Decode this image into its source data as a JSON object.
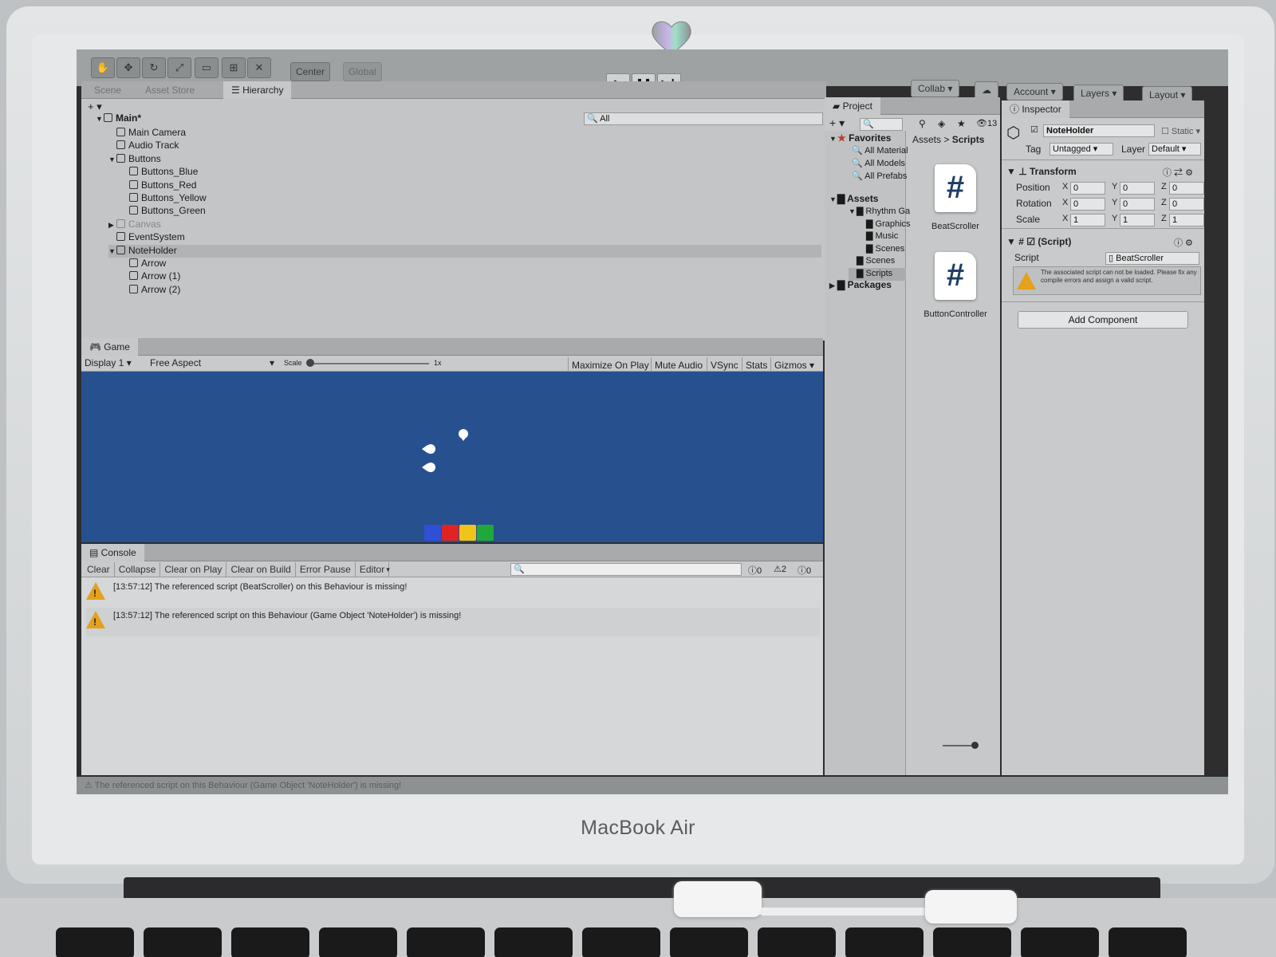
{
  "device": {
    "brand": "MacBook Air"
  },
  "toolbar": {
    "center_label": "Center",
    "global_label": "Global",
    "collab_label": "Collab",
    "account_label": "Account",
    "layers_label": "Layers",
    "layout_label": "Layout"
  },
  "hierarchy": {
    "tabs": [
      "Scene",
      "Asset Store",
      "Hierarchy"
    ],
    "search_placeholder": "All",
    "scene_name": "Main*",
    "items": [
      {
        "label": "Main Camera",
        "level": 1
      },
      {
        "label": "Audio Track",
        "level": 1
      },
      {
        "label": "Buttons",
        "level": 1
      },
      {
        "label": "Buttons_Blue",
        "level": 2
      },
      {
        "label": "Buttons_Red",
        "level": 2
      },
      {
        "label": "Buttons_Yellow",
        "level": 2
      },
      {
        "label": "Buttons_Green",
        "level": 2
      },
      {
        "label": "Canvas",
        "level": 1
      },
      {
        "label": "EventSystem",
        "level": 1
      },
      {
        "label": "NoteHolder",
        "level": 1
      },
      {
        "label": "Arrow",
        "level": 2
      },
      {
        "label": "Arrow (1)",
        "level": 2
      },
      {
        "label": "Arrow (2)",
        "level": 2
      }
    ]
  },
  "game": {
    "tab_label": "Game",
    "display": "Display 1",
    "aspect": "Free Aspect",
    "scale_label": "Scale",
    "scale_value": "1x",
    "controls": [
      "Maximize On Play",
      "Mute Audio",
      "VSync",
      "Stats",
      "Gizmos"
    ],
    "button_colors": [
      "#2f4fd6",
      "#e02424",
      "#f0c419",
      "#21a83b"
    ]
  },
  "console": {
    "tab_label": "Console",
    "buttons": [
      "Clear",
      "Collapse",
      "Clear on Play",
      "Clear on Build",
      "Error Pause",
      "Editor"
    ],
    "counts": {
      "info": "0",
      "warnings": "2",
      "errors": "0"
    },
    "messages": [
      "[13:57:12] The referenced script (BeatScroller) on this Behaviour is missing!",
      "[13:57:12] The referenced script on this Behaviour (Game Object 'NoteHolder') is missing!"
    ],
    "status_bar": "The referenced script on this Behaviour (Game Object 'NoteHolder') is missing!"
  },
  "project": {
    "tab_label": "Project",
    "hidden_count": "13",
    "favorites_label": "Favorites",
    "favorites": [
      "All Material",
      "All Models",
      "All Prefabs"
    ],
    "assets_label": "Assets",
    "tree": [
      {
        "label": "Rhythm Ga",
        "level": 1
      },
      {
        "label": "Graphics",
        "level": 2
      },
      {
        "label": "Music",
        "level": 2
      },
      {
        "label": "Scenes",
        "level": 2
      },
      {
        "label": "Scenes",
        "level": 1
      },
      {
        "label": "Scripts",
        "level": 1
      }
    ],
    "packages_label": "Packages",
    "breadcrumb": [
      "Assets",
      "Scripts"
    ],
    "files": [
      "BeatScroller",
      "ButtonController"
    ]
  },
  "inspector": {
    "tab_label": "Inspector",
    "object_name": "NoteHolder",
    "static_label": "Static",
    "tag_label": "Tag",
    "tag_value": "Untagged",
    "layer_label": "Layer",
    "layer_value": "Default",
    "transform_label": "Transform",
    "rows": [
      {
        "label": "Position",
        "x": "0",
        "y": "0",
        "z": "0"
      },
      {
        "label": "Rotation",
        "x": "0",
        "y": "0",
        "z": "0"
      },
      {
        "label": "Scale",
        "x": "1",
        "y": "1",
        "z": "1"
      }
    ],
    "script_component_label": "(Script)",
    "script_label": "Script",
    "script_value": "BeatScroller",
    "script_warning": "The associated script can not be loaded. Please fix any compile errors and assign a valid script.",
    "add_component_label": "Add Component"
  }
}
